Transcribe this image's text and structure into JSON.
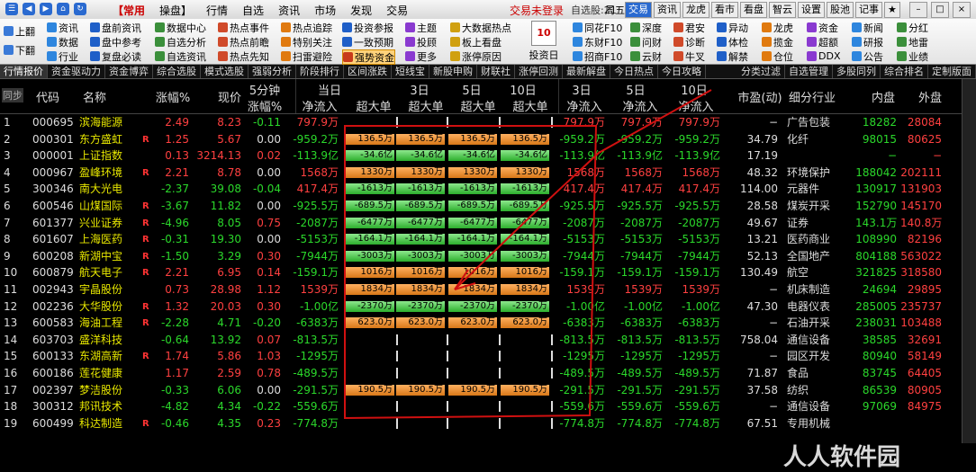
{
  "title_menu": [
    "【常用",
    "操盘】",
    "行情",
    "自选",
    "资讯",
    "市场",
    "发现",
    "交易"
  ],
  "trade_status": "交易未登录",
  "trade_count": "自选股:21",
  "weekday": "周五",
  "quick_tabs": [
    "交易",
    "资讯",
    "龙虎",
    "看市",
    "看盘",
    "智云",
    "设置",
    "股池",
    "记事"
  ],
  "ribbon": {
    "left_buttons": [
      "上翻",
      "下翻"
    ],
    "cols": [
      [
        "资讯",
        "数据",
        "行业"
      ],
      [
        "盘前资讯",
        "盘中参考",
        "复盘必读"
      ],
      [
        "数据中心",
        "自选分析",
        "自选资讯"
      ],
      [
        "热点事件",
        "热点前瞻",
        "热点先知"
      ],
      [
        "热点追踪",
        "特别关注",
        "扫雷避险"
      ],
      [
        "投资参报",
        "一致预期",
        "强势资金"
      ],
      [
        "主题",
        "投顾",
        "更多"
      ],
      [
        "大数据热点",
        "板上看盘",
        "涨停原因"
      ]
    ],
    "calendar_label": "投资日历",
    "calendar_day": "10",
    "cols_right": [
      [
        "同花F10",
        "东财F10",
        "招商F10"
      ],
      [
        "深度",
        "问财",
        "云财"
      ],
      [
        "异动",
        "体检",
        "解禁"
      ],
      [
        "龙虎",
        "揽金",
        "仓位"
      ],
      [
        "资金",
        "超额",
        "DDX"
      ],
      [
        "新闻",
        "研报",
        "公告"
      ],
      [
        "分红",
        "地雷",
        "业绩"
      ]
    ],
    "cols_mid": [
      [
        "君安",
        "诊断",
        "牛叉"
      ]
    ]
  },
  "tabs_left": [
    "行情报价",
    "资金驱动力",
    "资金博弈",
    "综合选股",
    "模式选股",
    "强弱分析",
    "阶段排行",
    "区间涨跌",
    "短线宝",
    "新股申购",
    "财联社",
    "涨停回测",
    "最新解盘",
    "今日热点",
    "今日攻略"
  ],
  "tabs_right": [
    "分类过滤",
    "自选管理",
    "多股同列",
    "综合排名",
    "定制版面"
  ],
  "headers": {
    "sync": "同步",
    "code": "代码",
    "name": "名称",
    "chg": "涨幅%",
    "price": "现价",
    "fivemin": "5分钟",
    "fivemin_sub": "涨幅%",
    "day": "当日",
    "day_sub": "净流入",
    "d3": "3日",
    "d5": "5日",
    "d10": "10日",
    "superbig": "超大单",
    "d3b": "3日",
    "d5b": "5日",
    "d10b": "10日",
    "netin": "净流入",
    "pe": "市盈(动)",
    "industry": "细分行业",
    "inner": "内盘",
    "outer": "外盘"
  },
  "rows": [
    {
      "n": "1",
      "code": "000695",
      "name": "滨海能源",
      "flag": "",
      "chg": "2.49",
      "price": "8.23",
      "m5": "-0.11",
      "net": "797.9万",
      "bar": "",
      "bars": "tick",
      "n3": "797.9万",
      "n5": "797.9万",
      "n10": "797.9万",
      "pe": "−",
      "ind": "广告包装",
      "in": "18282",
      "out": "28084"
    },
    {
      "n": "2",
      "code": "000301",
      "name": "东方盛虹",
      "flag": "R",
      "chg": "1.25",
      "price": "5.67",
      "m5": "0.00",
      "net": "-959.2万",
      "bar": "136.5万",
      "bars": "pos",
      "n3": "-959.2万",
      "n5": "-959.2万",
      "n10": "-959.2万",
      "pe": "34.79",
      "ind": "化纤",
      "in": "98015",
      "out": "80625"
    },
    {
      "n": "3",
      "code": "000001",
      "name": "上证指数",
      "flag": "",
      "chg": "0.13",
      "price": "3214.13",
      "m5": "0.02",
      "net": "-113.9亿",
      "bar": "-34.6亿",
      "bars": "neg",
      "n3": "-113.9亿",
      "n5": "-113.9亿",
      "n10": "-113.9亿",
      "pe": "17.19",
      "ind": "",
      "in": "−",
      "out": "−"
    },
    {
      "n": "4",
      "code": "000967",
      "name": "盈峰环境",
      "flag": "R",
      "chg": "2.21",
      "price": "8.78",
      "m5": "0.00",
      "net": "1568万",
      "bar": "1330万",
      "bars": "pos",
      "n3": "1568万",
      "n5": "1568万",
      "n10": "1568万",
      "pe": "48.32",
      "ind": "环境保护",
      "in": "188042",
      "out": "202111"
    },
    {
      "n": "5",
      "code": "300346",
      "name": "南大光电",
      "flag": "",
      "chg": "-2.37",
      "price": "39.08",
      "m5": "-0.04",
      "net": "417.4万",
      "bar": "-1613万",
      "bars": "neg",
      "n3": "417.4万",
      "n5": "417.4万",
      "n10": "417.4万",
      "pe": "114.00",
      "ind": "元器件",
      "in": "130917",
      "out": "131903"
    },
    {
      "n": "6",
      "code": "600546",
      "name": "山煤国际",
      "flag": "R",
      "chg": "-3.67",
      "price": "11.82",
      "m5": "0.00",
      "net": "-925.5万",
      "bar": "-689.5万",
      "bars": "neg",
      "n3": "-925.5万",
      "n5": "-925.5万",
      "n10": "-925.5万",
      "pe": "28.58",
      "ind": "煤炭开采",
      "in": "152790",
      "out": "145170"
    },
    {
      "n": "7",
      "code": "601377",
      "name": "兴业证券",
      "flag": "R",
      "chg": "-4.96",
      "price": "8.05",
      "m5": "0.75",
      "net": "-2087万",
      "bar": "-6477万",
      "bars": "neg",
      "n3": "-2087万",
      "n5": "-2087万",
      "n10": "-2087万",
      "pe": "49.67",
      "ind": "证券",
      "in": "143.1万",
      "out": "140.8万"
    },
    {
      "n": "8",
      "code": "601607",
      "name": "上海医药",
      "flag": "R",
      "chg": "-0.31",
      "price": "19.30",
      "m5": "0.00",
      "net": "-5153万",
      "bar": "-164.1万",
      "bars": "neg",
      "n3": "-5153万",
      "n5": "-5153万",
      "n10": "-5153万",
      "pe": "13.21",
      "ind": "医药商业",
      "in": "108990",
      "out": "82196"
    },
    {
      "n": "9",
      "code": "600208",
      "name": "新湖中宝",
      "flag": "R",
      "chg": "-1.50",
      "price": "3.29",
      "m5": "0.30",
      "net": "-7944万",
      "bar": "-3003万",
      "bars": "neg",
      "n3": "-7944万",
      "n5": "-7944万",
      "n10": "-7944万",
      "pe": "52.13",
      "ind": "全国地产",
      "in": "804188",
      "out": "563022"
    },
    {
      "n": "10",
      "code": "600879",
      "name": "航天电子",
      "flag": "R",
      "chg": "2.21",
      "price": "6.95",
      "m5": "0.14",
      "net": "-159.1万",
      "bar": "1016万",
      "bars": "pos",
      "n3": "-159.1万",
      "n5": "-159.1万",
      "n10": "-159.1万",
      "pe": "130.49",
      "ind": "航空",
      "in": "321825",
      "out": "318580"
    },
    {
      "n": "11",
      "code": "002943",
      "name": "宇晶股份",
      "flag": "",
      "chg": "0.73",
      "price": "28.98",
      "m5": "1.12",
      "net": "1539万",
      "bar": "1834万",
      "bars": "pos",
      "n3": "1539万",
      "n5": "1539万",
      "n10": "1539万",
      "pe": "−",
      "ind": "机床制造",
      "in": "24694",
      "out": "29895"
    },
    {
      "n": "12",
      "code": "002236",
      "name": "大华股份",
      "flag": "R",
      "chg": "1.32",
      "price": "20.03",
      "m5": "0.30",
      "net": "-1.00亿",
      "bar": "-2370万",
      "bars": "neg",
      "n3": "-1.00亿",
      "n5": "-1.00亿",
      "n10": "-1.00亿",
      "pe": "47.30",
      "ind": "电器仪表",
      "in": "285005",
      "out": "235737"
    },
    {
      "n": "13",
      "code": "600583",
      "name": "海油工程",
      "flag": "R",
      "chg": "-2.28",
      "price": "4.71",
      "m5": "-0.20",
      "net": "-6383万",
      "bar": "623.0万",
      "bars": "pos",
      "n3": "-6383万",
      "n5": "-6383万",
      "n10": "-6383万",
      "pe": "−",
      "ind": "石油开采",
      "in": "238031",
      "out": "103488"
    },
    {
      "n": "14",
      "code": "603703",
      "name": "盛洋科技",
      "flag": "",
      "chg": "-0.64",
      "price": "13.92",
      "m5": "0.07",
      "net": "-813.5万",
      "bar": "",
      "bars": "tick",
      "n3": "-813.5万",
      "n5": "-813.5万",
      "n10": "-813.5万",
      "pe": "758.04",
      "ind": "通信设备",
      "in": "38585",
      "out": "32691"
    },
    {
      "n": "15",
      "code": "600133",
      "name": "东湖高新",
      "flag": "R",
      "chg": "1.74",
      "price": "5.86",
      "m5": "1.03",
      "net": "-1295万",
      "bar": "",
      "bars": "tick",
      "n3": "-1295万",
      "n5": "-1295万",
      "n10": "-1295万",
      "pe": "−",
      "ind": "园区开发",
      "in": "80940",
      "out": "58149"
    },
    {
      "n": "16",
      "code": "600186",
      "name": "莲花健康",
      "flag": "",
      "chg": "1.17",
      "price": "2.59",
      "m5": "0.78",
      "net": "-489.5万",
      "bar": "",
      "bars": "tick",
      "n3": "-489.5万",
      "n5": "-489.5万",
      "n10": "-489.5万",
      "pe": "71.87",
      "ind": "食品",
      "in": "83745",
      "out": "64405"
    },
    {
      "n": "17",
      "code": "002397",
      "name": "梦洁股份",
      "flag": "",
      "chg": "-0.33",
      "price": "6.06",
      "m5": "0.00",
      "net": "-291.5万",
      "bar": "190.5万",
      "bars": "pos",
      "n3": "-291.5万",
      "n5": "-291.5万",
      "n10": "-291.5万",
      "pe": "37.58",
      "ind": "纺织",
      "in": "86539",
      "out": "80905"
    },
    {
      "n": "18",
      "code": "300312",
      "name": "邦讯技术",
      "flag": "",
      "chg": "-4.82",
      "price": "4.34",
      "m5": "-0.22",
      "net": "-559.6万",
      "bar": "",
      "bars": "tick",
      "n3": "-559.6万",
      "n5": "-559.6万",
      "n10": "-559.6万",
      "pe": "−",
      "ind": "通信设备",
      "in": "97069",
      "out": "84975"
    },
    {
      "n": "19",
      "code": "600499",
      "name": "科达制造",
      "flag": "R",
      "chg": "-0.46",
      "price": "4.35",
      "m5": "0.23",
      "net": "-774.8万",
      "bar": "",
      "bars": "tick",
      "n3": "-774.8万",
      "n5": "-774.8万",
      "n10": "-774.8万",
      "pe": "67.51",
      "ind": "专用机械",
      "in": "",
      "out": ""
    }
  ],
  "watermark": "人人软件园",
  "colors": {
    "up": "#ff4040",
    "down": "#2bd82b",
    "name": "#e8e800",
    "annotation": "#d01010"
  }
}
